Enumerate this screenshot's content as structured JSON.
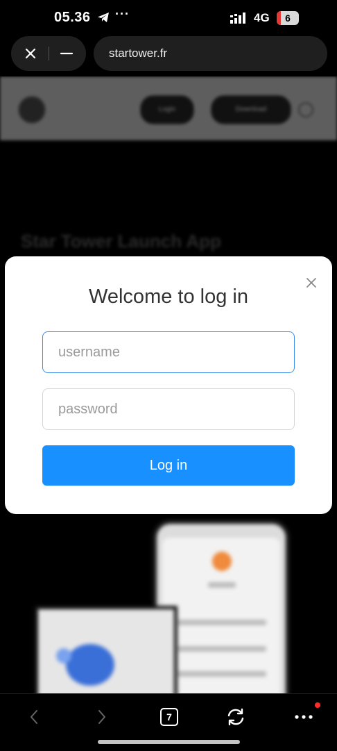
{
  "status_bar": {
    "time": "05.36",
    "telegram_icon": "telegram-icon",
    "more_notifications": "···",
    "network": "4G",
    "battery": "6",
    "battery_color": "#e53935"
  },
  "browser_bar": {
    "url": "startower.fr",
    "close_icon": "close-icon",
    "minimize_icon": "minimize-icon"
  },
  "background_page": {
    "header_button_1": "Login",
    "header_button_2": "Download",
    "headline": "Star Tower Launch App"
  },
  "login_modal": {
    "title": "Welcome to log in",
    "username_placeholder": "username",
    "username_value": "",
    "password_placeholder": "password",
    "password_value": "",
    "login_button": "Log in",
    "accent_color": "#1890ff"
  },
  "bottom_nav": {
    "tab_count": "7",
    "back_icon": "chevron-left-icon",
    "forward_icon": "chevron-right-icon",
    "refresh_icon": "refresh-icon",
    "more_icon": "more-dots-icon",
    "notification_dot_color": "#ff2b2b"
  }
}
